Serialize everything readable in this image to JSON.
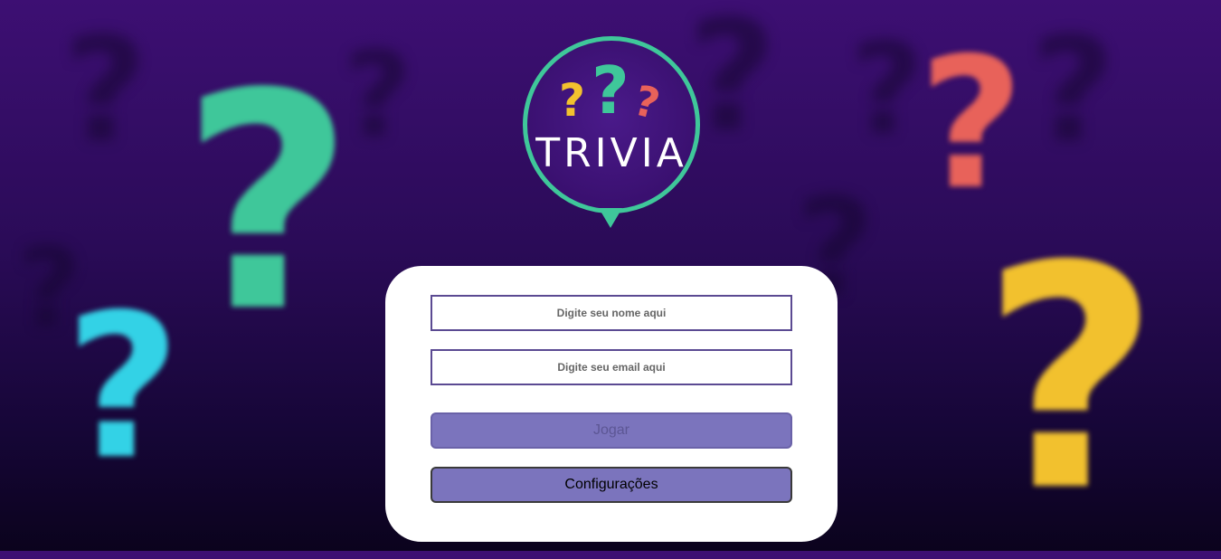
{
  "logo": {
    "title": "TRIVIA",
    "colors": {
      "ring": "#3fc79a",
      "yellow": "#f2c12e",
      "green": "#3fc79a",
      "red": "#e8625a"
    }
  },
  "background": {
    "icons": [
      "question-mark-icon"
    ],
    "colors": {
      "green": "#3fc79a",
      "cyan": "#33d2e6",
      "red": "#e8625a",
      "yellow": "#f2c12e"
    }
  },
  "form": {
    "name_placeholder": "Digite seu nome aqui",
    "email_placeholder": "Digite seu email aqui",
    "play_label": "Jogar",
    "settings_label": "Configurações"
  }
}
